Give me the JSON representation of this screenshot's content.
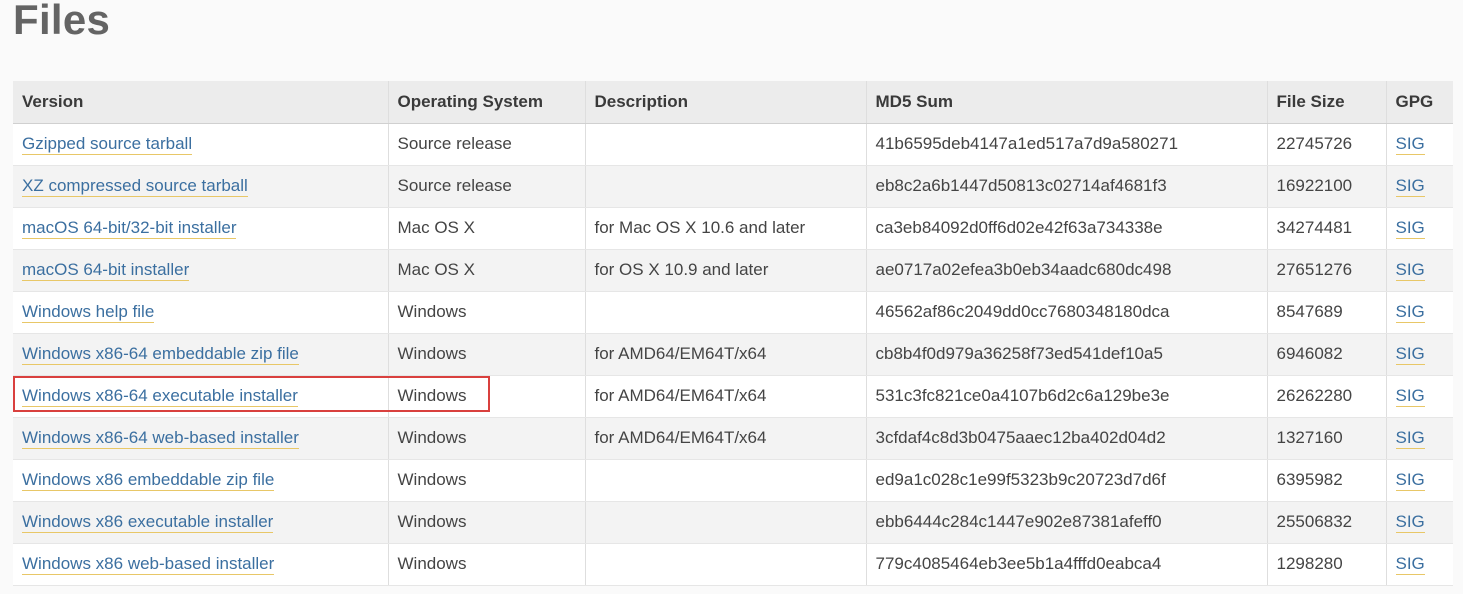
{
  "page": {
    "title": "Files"
  },
  "table": {
    "headers": [
      "Version",
      "Operating System",
      "Description",
      "MD5 Sum",
      "File Size",
      "GPG"
    ],
    "rows": [
      {
        "version": "Gzipped source tarball",
        "os": "Source release",
        "description": "",
        "md5": "41b6595deb4147a1ed517a7d9a580271",
        "size": "22745726",
        "gpg": "SIG"
      },
      {
        "version": "XZ compressed source tarball",
        "os": "Source release",
        "description": "",
        "md5": "eb8c2a6b1447d50813c02714af4681f3",
        "size": "16922100",
        "gpg": "SIG"
      },
      {
        "version": "macOS 64-bit/32-bit installer",
        "os": "Mac OS X",
        "description": "for Mac OS X 10.6 and later",
        "md5": "ca3eb84092d0ff6d02e42f63a734338e",
        "size": "34274481",
        "gpg": "SIG"
      },
      {
        "version": "macOS 64-bit installer",
        "os": "Mac OS X",
        "description": "for OS X 10.9 and later",
        "md5": "ae0717a02efea3b0eb34aadc680dc498",
        "size": "27651276",
        "gpg": "SIG"
      },
      {
        "version": "Windows help file",
        "os": "Windows",
        "description": "",
        "md5": "46562af86c2049dd0cc7680348180dca",
        "size": "8547689",
        "gpg": "SIG"
      },
      {
        "version": "Windows x86-64 embeddable zip file",
        "os": "Windows",
        "description": "for AMD64/EM64T/x64",
        "md5": "cb8b4f0d979a36258f73ed541def10a5",
        "size": "6946082",
        "gpg": "SIG"
      },
      {
        "version": "Windows x86-64 executable installer",
        "os": "Windows",
        "description": "for AMD64/EM64T/x64",
        "md5": "531c3fc821ce0a4107b6d2c6a129be3e",
        "size": "26262280",
        "gpg": "SIG"
      },
      {
        "version": "Windows x86-64 web-based installer",
        "os": "Windows",
        "description": "for AMD64/EM64T/x64",
        "md5": "3cfdaf4c8d3b0475aaec12ba402d04d2",
        "size": "1327160",
        "gpg": "SIG"
      },
      {
        "version": "Windows x86 embeddable zip file",
        "os": "Windows",
        "description": "",
        "md5": "ed9a1c028c1e99f5323b9c20723d7d6f",
        "size": "6395982",
        "gpg": "SIG"
      },
      {
        "version": "Windows x86 executable installer",
        "os": "Windows",
        "description": "",
        "md5": "ebb6444c284c1447e902e87381afeff0",
        "size": "25506832",
        "gpg": "SIG"
      },
      {
        "version": "Windows x86 web-based installer",
        "os": "Windows",
        "description": "",
        "md5": "779c4085464eb3ee5b1a4fffd0eabca4",
        "size": "1298280",
        "gpg": "SIG"
      }
    ]
  },
  "colors": {
    "link": "#3b6fa0",
    "link_underline": "#e8c767",
    "highlight": "#d9403e"
  }
}
